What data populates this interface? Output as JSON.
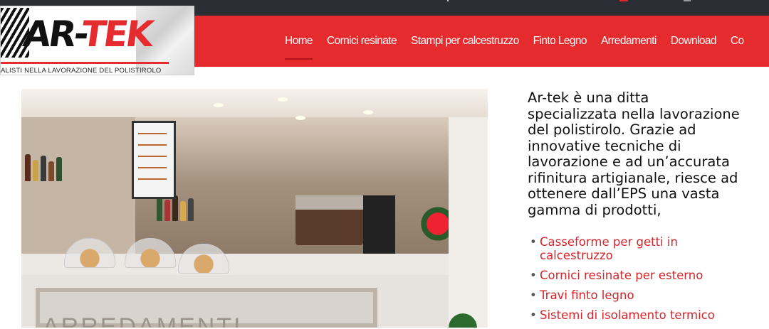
{
  "logo": {
    "text_ar": "AR-",
    "text_tek": "TEK",
    "tagline": "ALISTI NELLA LAVORAZIONE DEL POLISTIROLO"
  },
  "nav": {
    "items": [
      {
        "label": "Home",
        "active": true
      },
      {
        "label": "Cornici resinate"
      },
      {
        "label": "Stampi per calcestruzzo"
      },
      {
        "label": "Finto Legno"
      },
      {
        "label": "Arredamenti"
      },
      {
        "label": "Download"
      },
      {
        "label": "Co"
      }
    ]
  },
  "content": {
    "description": "Ar-tek è una ditta specializzata nella lavorazione del polistirolo. Grazie ad innovative tecniche di lavorazione e ad un’accurata rifinitura artigianale, riesce ad ottenere dall’EPS una vasta gamma di prodotti,",
    "products": [
      "Casseforme per getti in calcestruzzo",
      "Cornici resinate per esterno",
      "Travi finto legno",
      "Sistemi di isolamento termico"
    ],
    "photo_caption": "ARREDAMENTI"
  },
  "colors": {
    "brand_red": "#e52b2e",
    "topbar": "#2c2d35",
    "link_red": "#d5242a"
  }
}
